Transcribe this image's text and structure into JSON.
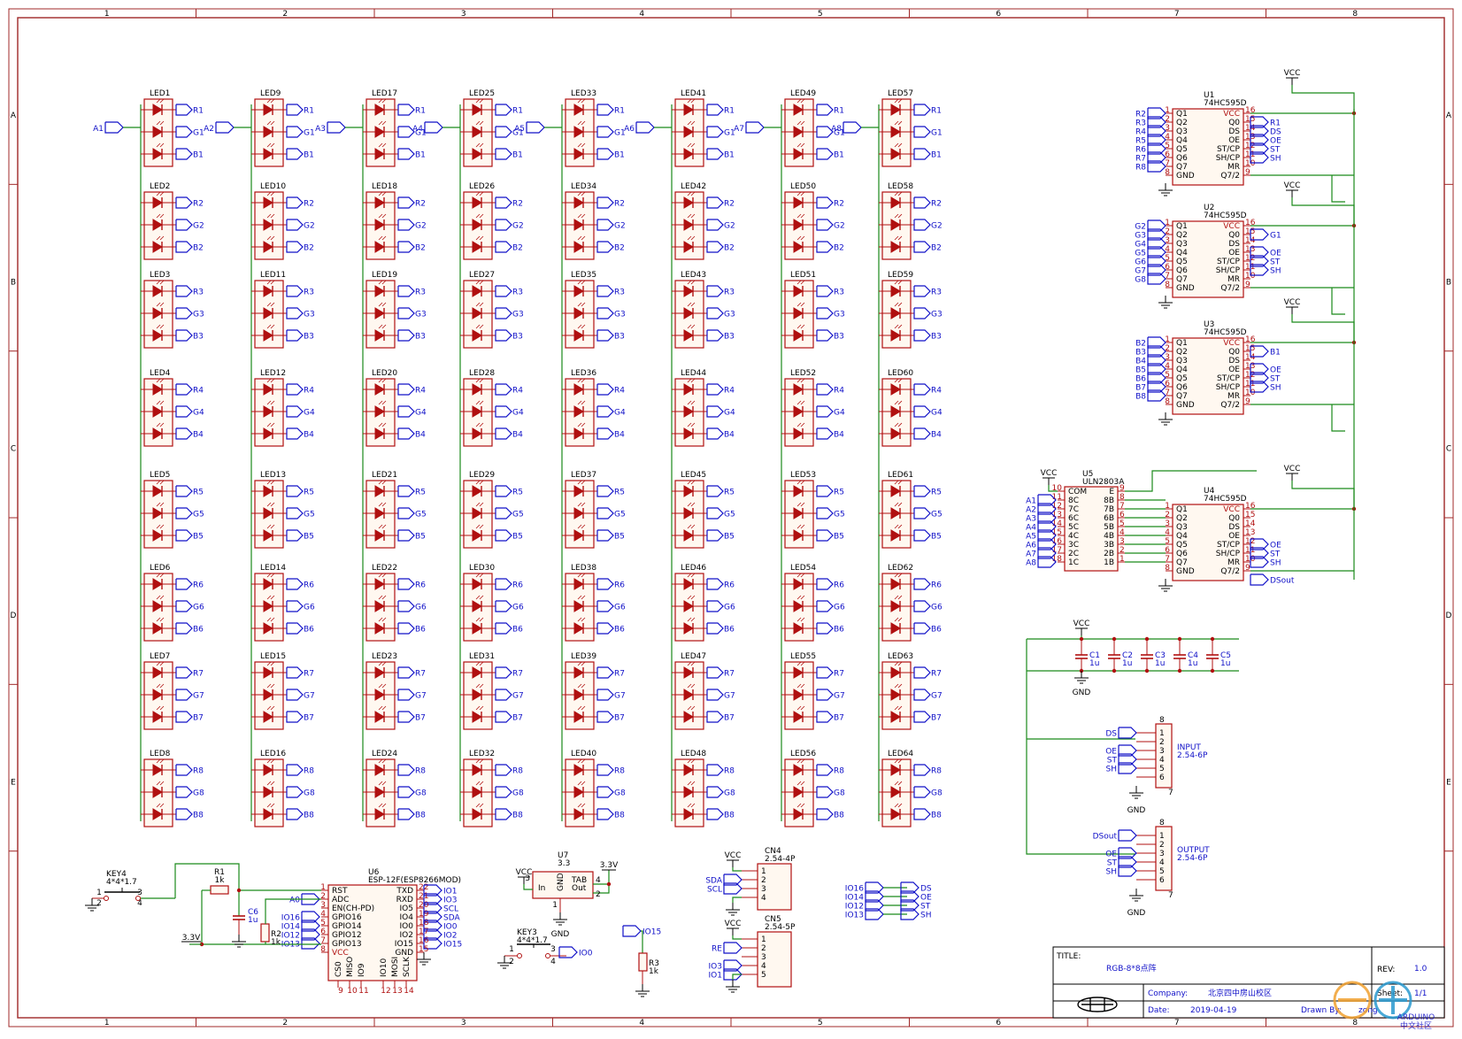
{
  "frame": {
    "columns": [
      "1",
      "2",
      "3",
      "4",
      "5",
      "6",
      "7",
      "8"
    ],
    "rows": [
      "A",
      "B",
      "C",
      "D",
      "E"
    ]
  },
  "led_matrix": {
    "anodes": [
      "A1",
      "A2",
      "A3",
      "A4",
      "A5",
      "A6",
      "A7",
      "A8"
    ],
    "row_labels": [
      [
        "R1",
        "G1",
        "B1"
      ],
      [
        "R2",
        "G2",
        "B2"
      ],
      [
        "R3",
        "G3",
        "B3"
      ],
      [
        "R4",
        "G4",
        "B4"
      ],
      [
        "R5",
        "G5",
        "B5"
      ],
      [
        "R6",
        "G6",
        "B6"
      ],
      [
        "R7",
        "G7",
        "B7"
      ],
      [
        "R8",
        "G8",
        "B8"
      ]
    ]
  },
  "shift_registers": [
    {
      "ref": "U1",
      "part": "74HC595D",
      "vcc_label": "VCC",
      "inputs": [
        "R2",
        "R3",
        "R4",
        "R5",
        "R6",
        "R7",
        "R8"
      ],
      "right_nets": [
        "R1",
        "DS",
        "OE",
        "ST",
        "SH"
      ]
    },
    {
      "ref": "U2",
      "part": "74HC595D",
      "vcc_label": "VCC",
      "inputs": [
        "G2",
        "G3",
        "G4",
        "G5",
        "G6",
        "G7",
        "G8"
      ],
      "right_nets": [
        "G1",
        "OE",
        "ST",
        "SH"
      ]
    },
    {
      "ref": "U3",
      "part": "74HC595D",
      "vcc_label": "VCC",
      "inputs": [
        "B2",
        "B3",
        "B4",
        "B5",
        "B6",
        "B7",
        "B8"
      ],
      "right_nets": [
        "B1",
        "OE",
        "ST",
        "SH"
      ]
    },
    {
      "ref": "U4",
      "part": "74HC595D",
      "vcc_label": "VCC",
      "inputs": [],
      "right_nets": [
        "OE",
        "ST",
        "SH",
        "DSout"
      ]
    }
  ],
  "hc595_pins": {
    "left": [
      [
        "1",
        "Q1"
      ],
      [
        "2",
        "Q2"
      ],
      [
        "3",
        "Q3"
      ],
      [
        "4",
        "Q4"
      ],
      [
        "5",
        "Q5"
      ],
      [
        "6",
        "Q6"
      ],
      [
        "7",
        "Q7"
      ],
      [
        "8",
        "GND"
      ]
    ],
    "right": [
      [
        "16",
        "VCC"
      ],
      [
        "15",
        "Q0"
      ],
      [
        "14",
        "DS"
      ],
      [
        "13",
        "OE"
      ],
      [
        "12",
        "ST/CP"
      ],
      [
        "11",
        "SH/CP"
      ],
      [
        "10",
        "MR"
      ],
      [
        "9",
        "Q7/2"
      ]
    ]
  },
  "uln": {
    "ref": "U5",
    "part": "ULN2803A",
    "vcc_label": "VCC",
    "inputs": [
      "A1",
      "A2",
      "A3",
      "A4",
      "A5",
      "A6",
      "A7",
      "A8"
    ],
    "left_pins": [
      [
        "10",
        "COM"
      ],
      [
        "11",
        "8C"
      ],
      [
        "12",
        "7C"
      ],
      [
        "13",
        "6C"
      ],
      [
        "14",
        "5C"
      ],
      [
        "15",
        "4C"
      ],
      [
        "16",
        "3C"
      ],
      [
        "17",
        "2C"
      ],
      [
        "18",
        "1C"
      ]
    ],
    "right_pins": [
      [
        "9",
        "E"
      ],
      [
        "8",
        "8B"
      ],
      [
        "7",
        "7B"
      ],
      [
        "6",
        "6B"
      ],
      [
        "5",
        "5B"
      ],
      [
        "4",
        "4B"
      ],
      [
        "3",
        "3B"
      ],
      [
        "2",
        "2B"
      ],
      [
        "1",
        "1B"
      ]
    ]
  },
  "caps": {
    "vcc": "VCC",
    "gnd": "GND",
    "items": [
      {
        "ref": "C1",
        "val": "1u"
      },
      {
        "ref": "C2",
        "val": "1u"
      },
      {
        "ref": "C3",
        "val": "1u"
      },
      {
        "ref": "C4",
        "val": "1u"
      },
      {
        "ref": "C5",
        "val": "1u"
      }
    ]
  },
  "input_conn": {
    "title": "INPUT",
    "part": "2.54-6P",
    "nets": [
      "DS",
      "",
      "OE",
      "ST",
      "SH",
      ""
    ],
    "pins": [
      "1",
      "2",
      "3",
      "4",
      "5",
      "6"
    ],
    "top": "8",
    "bot": "7",
    "gnd": "GND"
  },
  "output_conn": {
    "title": "OUTPUT",
    "part": "2.54-6P",
    "nets": [
      "DSout",
      "",
      "OE",
      "ST",
      "SH",
      ""
    ],
    "pins": [
      "1",
      "2",
      "3",
      "4",
      "5",
      "6"
    ],
    "top": "8",
    "bot": "7",
    "gnd": "GND"
  },
  "esp": {
    "ref": "U6",
    "part": "ESP-12F(ESP8266MOD)",
    "left_pins": [
      [
        "1",
        "RST"
      ],
      [
        "2",
        "ADC"
      ],
      [
        "3",
        "EN(CH-PD)"
      ],
      [
        "4",
        "GPIO16"
      ],
      [
        "5",
        "GPIO14"
      ],
      [
        "6",
        "GPIO12"
      ],
      [
        "7",
        "GPIO13"
      ],
      [
        "8",
        "VCC"
      ]
    ],
    "left_nets": [
      "",
      "A0",
      "",
      "IO16",
      "IO14",
      "IO12",
      "IO13",
      "3.3V"
    ],
    "right_pins": [
      [
        "22",
        "TXD"
      ],
      [
        "21",
        "RXD"
      ],
      [
        "20",
        "IO5"
      ],
      [
        "19",
        "IO4"
      ],
      [
        "18",
        "IO0"
      ],
      [
        "17",
        "IO2"
      ],
      [
        "16",
        "IO15"
      ],
      [
        "15",
        "GND"
      ]
    ],
    "right_nets": [
      "IO1",
      "IO3",
      "SCL",
      "SDA",
      "IO0",
      "IO2",
      "IO15",
      ""
    ],
    "bottom_pins": [
      "CS0",
      "MISO",
      "IO9",
      "IO10",
      "MOSI",
      "SCLK"
    ],
    "bottom_nums": [
      "9",
      "10",
      "11",
      "12",
      "13",
      "14"
    ]
  },
  "key4": {
    "ref": "KEY4",
    "part": "4*4*1.7",
    "pins": [
      "1",
      "2",
      "3",
      "4"
    ]
  },
  "r1": {
    "ref": "R1",
    "val": "1k"
  },
  "r2": {
    "ref": "R2",
    "val": "1k"
  },
  "c6": {
    "ref": "C6",
    "val": "1u"
  },
  "v33": "3.3V",
  "reg": {
    "ref": "U7",
    "part": "3.3",
    "in": "In",
    "out": "Out",
    "gnd": "GND",
    "tab": "TAB",
    "vcc": "VCC",
    "out_net": "3.3V",
    "gnd_net": "GND",
    "pins": [
      "3",
      "1",
      "2",
      "4"
    ]
  },
  "key3": {
    "ref": "KEY3",
    "part": "4*4*1.7",
    "net": "IO0",
    "pins": [
      "1",
      "2",
      "3",
      "4"
    ]
  },
  "r3": {
    "ref": "R3",
    "val": "1k",
    "net": "IO15"
  },
  "cn4": {
    "ref": "CN4",
    "part": "2.54-4P",
    "vcc": "VCC",
    "nets": [
      "",
      "SDA",
      "SCL",
      ""
    ],
    "pins": [
      "1",
      "2",
      "3",
      "4"
    ]
  },
  "cn5": {
    "ref": "CN5",
    "part": "2.54-5P",
    "vcc": "VCC",
    "nets": [
      "",
      "RE",
      "",
      "IO3",
      "IO1"
    ],
    "pins": [
      "1",
      "2",
      "3",
      "4",
      "5"
    ]
  },
  "netmap": {
    "left": [
      "IO16",
      "IO14",
      "IO12",
      "IO13"
    ],
    "right": [
      "DS",
      "OE",
      "ST",
      "SH"
    ]
  },
  "title_block": {
    "title_label": "TITLE:",
    "title": "RGB-8*8点阵",
    "rev_label": "REV:",
    "rev": "1.0",
    "company_label": "Company:",
    "company": "北京四中房山校区",
    "sheet_label": "Sheet:",
    "sheet": "1/1",
    "date_label": "Date:",
    "date": "2019-04-19",
    "drawn_label": "Drawn By:",
    "drawn": "zong"
  },
  "watermark": {
    "line1": "ARDUINO",
    "line2": "中文社区"
  },
  "colors": {
    "wire": "#1a8a1a",
    "part": "#b01010",
    "net": "#1010c8",
    "frame": "#a02828",
    "body": "#fff8f0"
  }
}
